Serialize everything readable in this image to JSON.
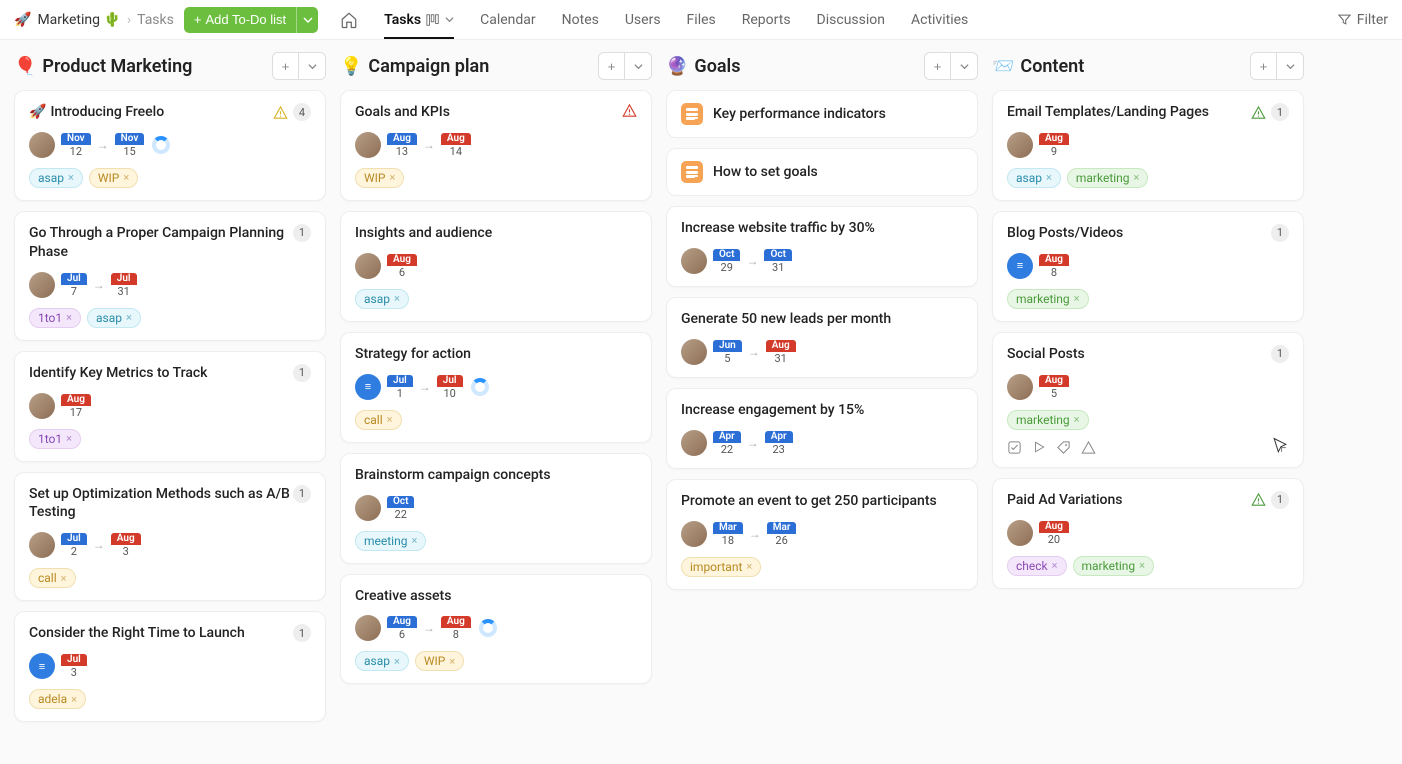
{
  "breadcrumb": {
    "emoji": "🚀",
    "project": "Marketing 🌵",
    "section": "Tasks"
  },
  "add_button": "Add To-Do list",
  "nav": [
    "Tasks",
    "Calendar",
    "Notes",
    "Users",
    "Files",
    "Reports",
    "Discussion",
    "Activities"
  ],
  "filter_label": "Filter",
  "columns": [
    {
      "emoji": "🎈",
      "title": "Product Marketing",
      "cards": [
        {
          "title": "Introducing Freelo",
          "title_emoji": "🚀",
          "warn": "yellow",
          "count": "4",
          "avatar": "photo",
          "dates": [
            {
              "m": "Nov",
              "d": "12",
              "c": "#2a6ed6"
            },
            {
              "m": "Nov",
              "d": "15",
              "c": "#2a6ed6"
            }
          ],
          "spinner": true,
          "tags": [
            {
              "t": "asap",
              "cls": "tag-asap"
            },
            {
              "t": "WIP",
              "cls": "tag-wip"
            }
          ]
        },
        {
          "title": "Go Through a Proper Campaign Planning Phase",
          "count": "1",
          "avatar": "photo",
          "dates": [
            {
              "m": "Jul",
              "d": "7",
              "c": "#2a6ed6"
            },
            {
              "m": "Jul",
              "d": "31",
              "c": "#d43a2a"
            }
          ],
          "tags": [
            {
              "t": "1to1",
              "cls": "tag-1to1"
            },
            {
              "t": "asap",
              "cls": "tag-asap"
            }
          ]
        },
        {
          "title": "Identify Key Metrics to Track",
          "count": "1",
          "avatar": "photo",
          "dates": [
            {
              "m": "Aug",
              "d": "17",
              "c": "#d43a2a"
            }
          ],
          "tags": [
            {
              "t": "1to1",
              "cls": "tag-1to1"
            }
          ]
        },
        {
          "title": "Set up Optimization Methods such as A/B Testing",
          "count": "1",
          "avatar": "photo",
          "dates": [
            {
              "m": "Jul",
              "d": "2",
              "c": "#2a6ed6"
            },
            {
              "m": "Aug",
              "d": "3",
              "c": "#d43a2a"
            }
          ],
          "tags": [
            {
              "t": "call",
              "cls": "tag-call"
            }
          ]
        },
        {
          "title": "Consider the Right Time to Launch",
          "count": "1",
          "avatar": "blue",
          "dates": [
            {
              "m": "Jul",
              "d": "3",
              "c": "#d43a2a"
            }
          ],
          "tags": [
            {
              "t": "adela",
              "cls": "tag-adela"
            }
          ]
        }
      ]
    },
    {
      "emoji": "💡",
      "title": "Campaign plan",
      "cards": [
        {
          "title": "Goals and KPIs",
          "warn": "red",
          "avatar": "photo",
          "dates": [
            {
              "m": "Aug",
              "d": "13",
              "c": "#2a6ed6"
            },
            {
              "m": "Aug",
              "d": "14",
              "c": "#d43a2a"
            }
          ],
          "tags": [
            {
              "t": "WIP",
              "cls": "tag-wip"
            }
          ]
        },
        {
          "title": "Insights and audience",
          "avatar": "photo",
          "dates": [
            {
              "m": "Aug",
              "d": "6",
              "c": "#d43a2a"
            }
          ],
          "tags": [
            {
              "t": "asap",
              "cls": "tag-asap"
            }
          ]
        },
        {
          "title": "Strategy for action",
          "avatar": "blue",
          "dates": [
            {
              "m": "Jul",
              "d": "1",
              "c": "#2a6ed6"
            },
            {
              "m": "Jul",
              "d": "10",
              "c": "#d43a2a"
            }
          ],
          "spinner": true,
          "tags": [
            {
              "t": "call",
              "cls": "tag-call"
            }
          ]
        },
        {
          "title": "Brainstorm campaign concepts",
          "avatar": "photo",
          "dates": [
            {
              "m": "Oct",
              "d": "22",
              "c": "#2a6ed6"
            }
          ],
          "tags": [
            {
              "t": "meeting",
              "cls": "tag-meeting"
            }
          ]
        },
        {
          "title": "Creative assets",
          "avatar": "photo",
          "dates": [
            {
              "m": "Aug",
              "d": "6",
              "c": "#2a6ed6"
            },
            {
              "m": "Aug",
              "d": "8",
              "c": "#d43a2a"
            }
          ],
          "spinner": true,
          "tags": [
            {
              "t": "asap",
              "cls": "tag-asap"
            },
            {
              "t": "WIP",
              "cls": "tag-wip"
            }
          ]
        }
      ]
    },
    {
      "emoji": "🔮",
      "title": "Goals",
      "notes": [
        {
          "text": "Key performance indicators"
        },
        {
          "text": "How to set goals"
        }
      ],
      "cards": [
        {
          "title": "Increase website traffic by 30%",
          "avatar": "photo",
          "dates": [
            {
              "m": "Oct",
              "d": "29",
              "c": "#2a6ed6"
            },
            {
              "m": "Oct",
              "d": "31",
              "c": "#2a6ed6"
            }
          ]
        },
        {
          "title": "Generate 50 new leads per month",
          "avatar": "photo",
          "dates": [
            {
              "m": "Jun",
              "d": "5",
              "c": "#2a6ed6"
            },
            {
              "m": "Aug",
              "d": "31",
              "c": "#d43a2a"
            }
          ]
        },
        {
          "title": "Increase engagement by 15%",
          "avatar": "photo",
          "dates": [
            {
              "m": "Apr",
              "d": "22",
              "c": "#2a6ed6"
            },
            {
              "m": "Apr",
              "d": "23",
              "c": "#2a6ed6"
            }
          ]
        },
        {
          "title": "Promote an event to get 250 participants",
          "avatar": "photo",
          "dates": [
            {
              "m": "Mar",
              "d": "18",
              "c": "#2a6ed6"
            },
            {
              "m": "Mar",
              "d": "26",
              "c": "#2a6ed6"
            }
          ],
          "tags": [
            {
              "t": "important",
              "cls": "tag-important"
            }
          ]
        }
      ]
    },
    {
      "emoji": "📨",
      "title": "Content",
      "cards": [
        {
          "title": "Email Templates/Landing Pages",
          "warn": "green",
          "count": "1",
          "avatar": "photo",
          "dates": [
            {
              "m": "Aug",
              "d": "9",
              "c": "#d43a2a"
            }
          ],
          "tags": [
            {
              "t": "asap",
              "cls": "tag-asap"
            },
            {
              "t": "marketing",
              "cls": "tag-marketing"
            }
          ]
        },
        {
          "title": "Blog Posts/Videos",
          "count": "1",
          "avatar": "blue",
          "dates": [
            {
              "m": "Aug",
              "d": "8",
              "c": "#d43a2a"
            }
          ],
          "tags": [
            {
              "t": "marketing",
              "cls": "tag-marketing"
            }
          ]
        },
        {
          "title": "Social Posts",
          "count": "1",
          "avatar": "photo",
          "dates": [
            {
              "m": "Aug",
              "d": "5",
              "c": "#d43a2a"
            }
          ],
          "tags": [
            {
              "t": "marketing",
              "cls": "tag-marketing"
            }
          ],
          "hover_actions": true
        },
        {
          "title": "Paid Ad Variations",
          "warn": "green",
          "count": "1",
          "avatar": "photo",
          "dates": [
            {
              "m": "Aug",
              "d": "20",
              "c": "#d43a2a"
            }
          ],
          "tags": [
            {
              "t": "check",
              "cls": "tag-check"
            },
            {
              "t": "marketing",
              "cls": "tag-marketing"
            }
          ]
        }
      ]
    }
  ]
}
